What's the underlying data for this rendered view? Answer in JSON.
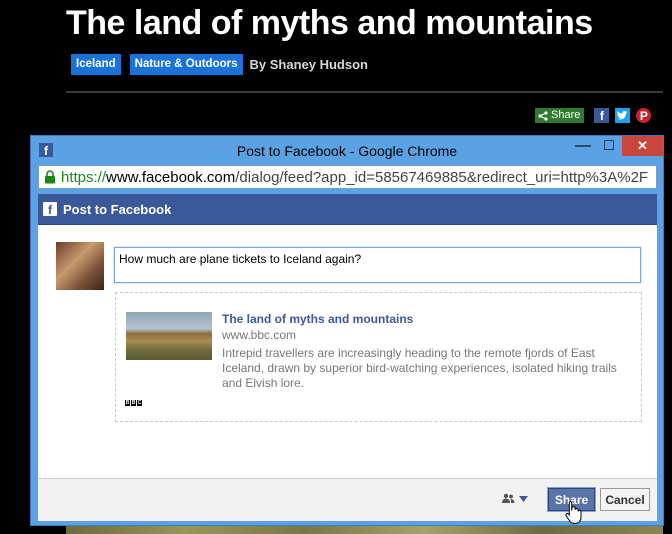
{
  "article": {
    "title": "The land of myths and mountains",
    "tags": [
      "Iceland",
      "Nature & Outdoors"
    ],
    "byline": "By Shaney Hudson",
    "share_label": "Share",
    "social_icons": [
      "facebook-icon",
      "twitter-icon",
      "pinterest-icon"
    ]
  },
  "window": {
    "title": "Post to Facebook - Google Chrome",
    "controls": {
      "minimize": "—",
      "maximize": "□",
      "close": "✕"
    },
    "address": {
      "scheme": "https://",
      "host": "www.facebook.com",
      "path": "/dialog/feed?app_id=58567469885&redirect_uri=http%3A%2F"
    }
  },
  "dialog": {
    "header_title": "Post to Facebook",
    "message_value": "How much are plane tickets to Iceland again?",
    "preview": {
      "title": "The land of myths and mountains",
      "domain": "www.bbc.com",
      "description": "Intrepid travellers are increasingly heading to the remote fjords of East Iceland, drawn by superior bird-watching experiences, isolated hiking trails and Elvish lore.",
      "logo_letters": [
        "B",
        "B",
        "C"
      ]
    },
    "buttons": {
      "share": "Share",
      "cancel": "Cancel"
    }
  },
  "colors": {
    "facebook_blue": "#3b5998",
    "tag_blue": "#1a73d9",
    "share_green": "#2f7a2f",
    "window_frame": "#5ba2e4",
    "close_red": "#c9463d"
  }
}
